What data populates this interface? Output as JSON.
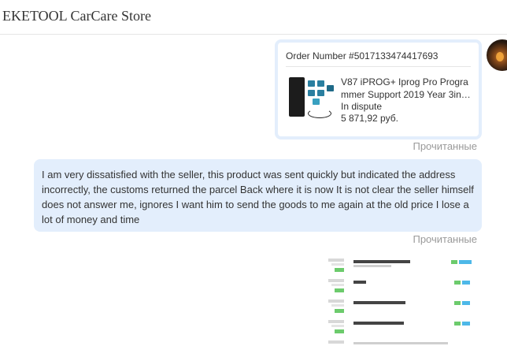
{
  "header": {
    "store_name": "EKETOOL CarCare Store"
  },
  "order_card": {
    "order_number": "Order Number #5017133474417693",
    "product_name_line1": "V87 iPROG+ Iprog Pro Progra",
    "product_name_line2": "mmer Support 2019 Year 3in…",
    "status": "In dispute",
    "price": "5 871,92 руб."
  },
  "read_status_1": "Прочитанные",
  "message": {
    "text": "I am very dissatisfied with the seller, this product was sent quickly but indicated the address incorrectly, the customs returned the parcel Back where it is now It is not clear the seller himself does not answer me, ignores I want him to send the goods to me again at the old price I lose a lot of money and time"
  },
  "read_status_2": "Прочитанные",
  "attachment": {
    "icon": "image-attachment-icon"
  }
}
